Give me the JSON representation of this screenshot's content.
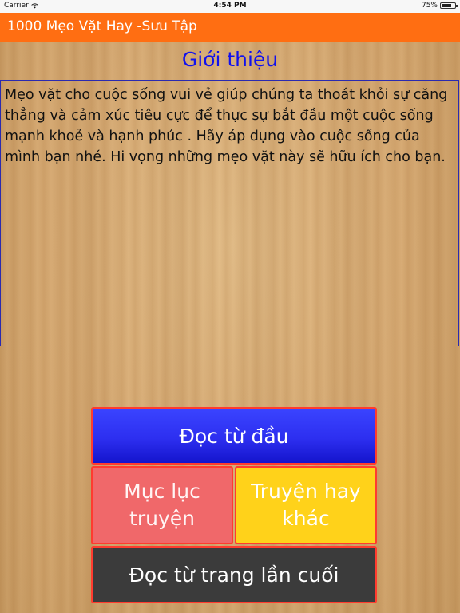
{
  "status_bar": {
    "carrier": "Carrier",
    "time": "4:54 PM",
    "battery_percent": "75%",
    "battery_level": 0.75
  },
  "app_bar": {
    "title": "1000 Mẹo Vặt Hay -Sưu Tập",
    "color": "#ff6e12"
  },
  "page": {
    "title": "Giới thiệu",
    "description": "Mẹo vặt cho cuộc sống vui vẻ giúp chúng ta thoát khỏi sự căng thẳng và cảm xúc tiêu cực để thực sự bắt đầu một cuộc sống mạnh khoẻ và hạnh phúc . Hãy áp dụng vào cuộc sống của mình bạn nhé. Hi vọng những mẹo vặt này sẽ hữu ích cho bạn."
  },
  "buttons": {
    "read_from_start": "Đọc từ đầu",
    "table_of_contents_line1": "Mục lục",
    "table_of_contents_line2": "truyện",
    "other_stories_line1": "Truyện hay",
    "other_stories_line2": "khác",
    "read_from_last_page": "Đọc từ trang lần cuối"
  },
  "colors": {
    "title_blue": "#1111ee",
    "button_border": "#ff3b2f",
    "button_blue": "#2d2ff0",
    "button_red": "#f0686a",
    "button_yellow": "#ffd21a",
    "button_dark": "#3b3b3b"
  }
}
